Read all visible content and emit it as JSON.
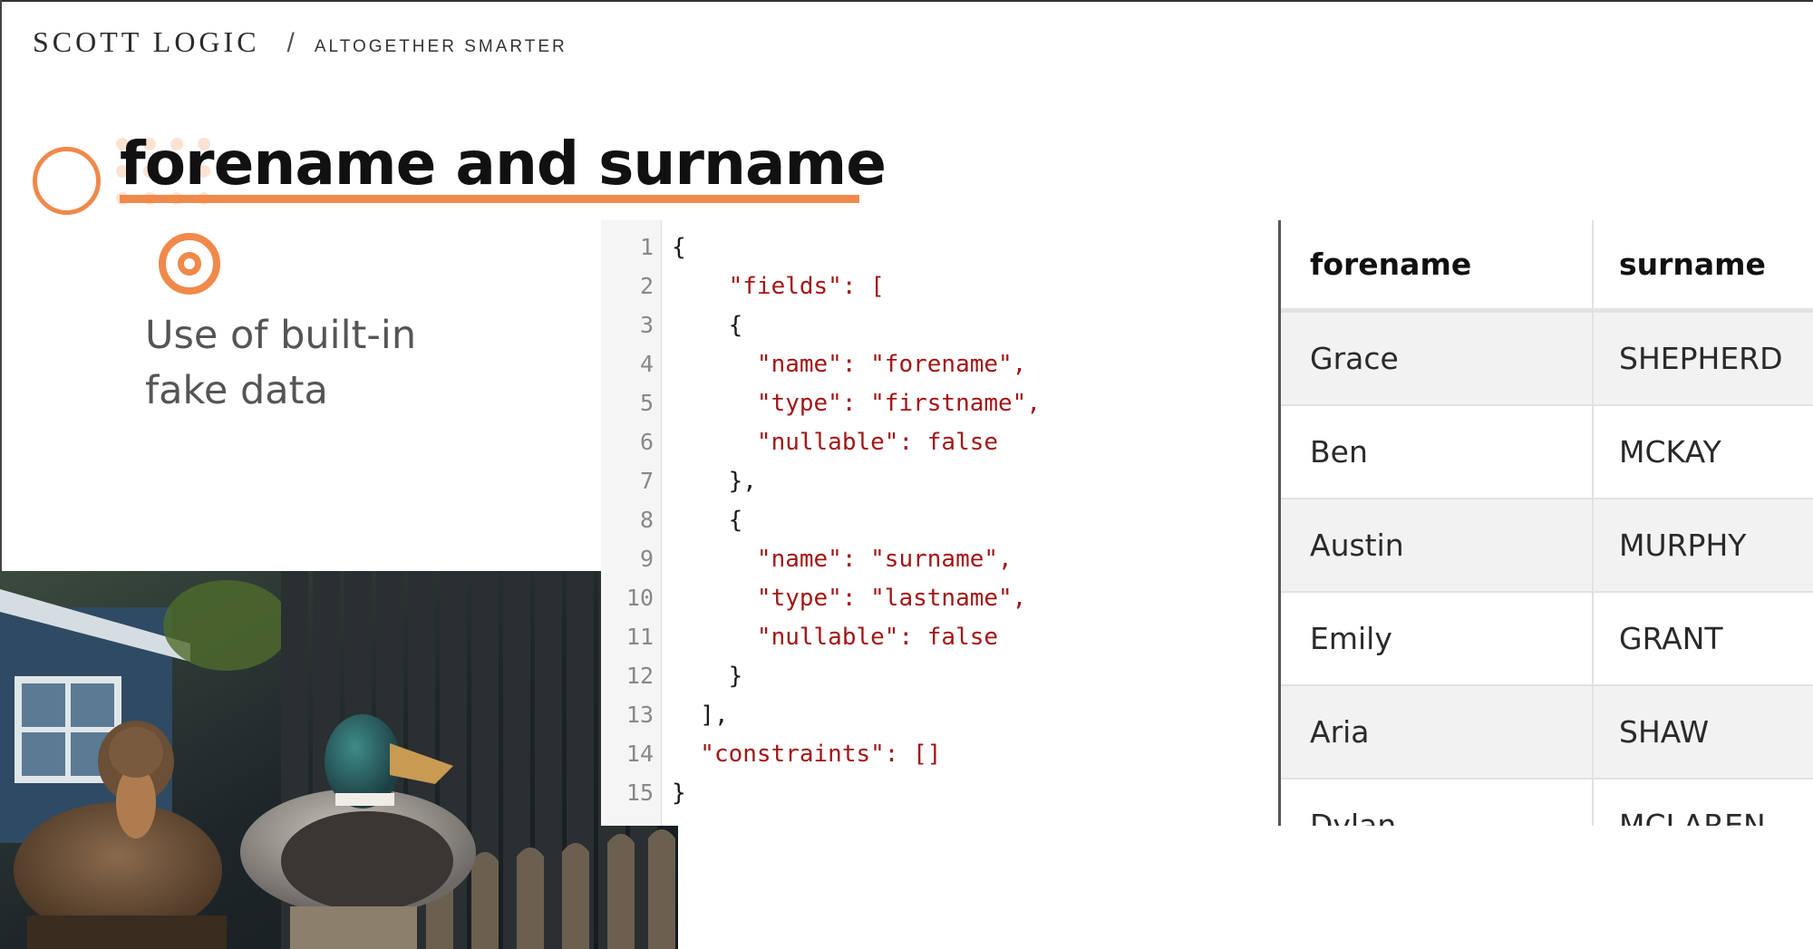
{
  "brand": {
    "name": "SCOTT LOGIC",
    "separator": "/",
    "tagline": "ALTOGETHER SMARTER"
  },
  "slide": {
    "title": "forename and surname",
    "bullet": "Use of built-in fake data"
  },
  "code": {
    "line_numbers": [
      "1",
      "2",
      "3",
      "4",
      "5",
      "6",
      "7",
      "8",
      "9",
      "10",
      "11",
      "12",
      "13",
      "14",
      "15"
    ],
    "lines": [
      "{",
      "    \"fields\": [",
      "    {",
      "      \"name\": \"forename\",",
      "      \"type\": \"firstname\",",
      "      \"nullable\": false",
      "    },",
      "    {",
      "      \"name\": \"surname\",",
      "      \"type\": \"lastname\",",
      "      \"nullable\": false",
      "    }",
      "  ],",
      "  \"constraints\": []",
      "}"
    ]
  },
  "table": {
    "headers": [
      "forename",
      "surname"
    ],
    "rows": [
      [
        "Grace",
        "SHEPHERD"
      ],
      [
        "Ben",
        "MCKAY"
      ],
      [
        "Austin",
        "MURPHY"
      ],
      [
        "Emily",
        "GRANT"
      ],
      [
        "Aria",
        "SHAW"
      ],
      [
        "Dylan",
        "MCLAREN"
      ]
    ]
  },
  "colors": {
    "accent": "#f0894a",
    "json_key": "#a31515",
    "json_bool": "#1a1aa6"
  }
}
